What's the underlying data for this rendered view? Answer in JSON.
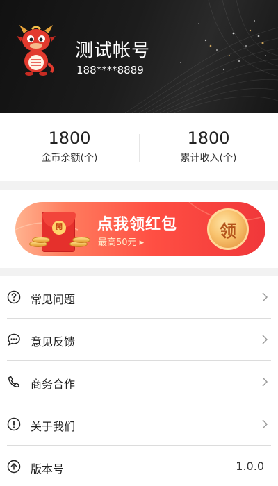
{
  "profile": {
    "username": "测试帐号",
    "phone": "188****8889",
    "avatar_icon": "dragon-mascot-icon"
  },
  "stats": [
    {
      "value": "1800",
      "label": "金币余额(个)"
    },
    {
      "value": "1800",
      "label": "累计收入(个)"
    }
  ],
  "banner": {
    "title": "点我领红包",
    "subtitle": "最高50元 ▸",
    "coin_label": "领",
    "envelope_label": "開"
  },
  "menu": [
    {
      "label": "常见问题",
      "icon": "question-icon"
    },
    {
      "label": "意见反馈",
      "icon": "chat-bubble-icon"
    },
    {
      "label": "商务合作",
      "icon": "phone-icon"
    },
    {
      "label": "关于我们",
      "icon": "info-icon"
    },
    {
      "label": "版本号",
      "icon": "upload-icon",
      "value": "1.0.0"
    }
  ],
  "colors": {
    "header_bg": "#1a1a1a",
    "banner_red": "#f0373a",
    "coin_gold": "#f8c26d"
  }
}
